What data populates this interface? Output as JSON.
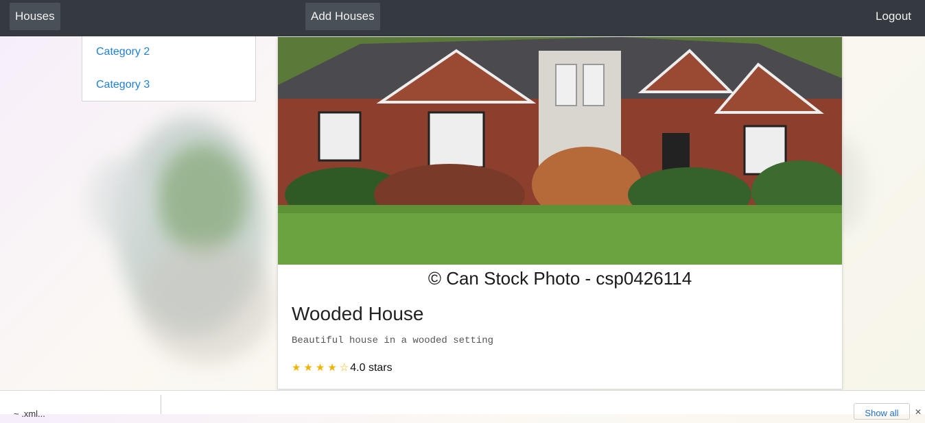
{
  "navbar": {
    "houses_label": "Houses",
    "add_houses_label": "Add Houses",
    "logout_label": "Logout"
  },
  "dropdown": {
    "items": [
      {
        "label": "Category 2"
      },
      {
        "label": "Category 3"
      }
    ]
  },
  "card": {
    "image_caption": "© Can Stock Photo - csp0426114",
    "title": "Wooded House",
    "description": "Beautiful house in a wooded setting",
    "rating": {
      "value": 4,
      "max": 5,
      "label": "4.0 stars",
      "star_color": "#f0b400"
    }
  },
  "downloads_bar": {
    "file_label": "~ .xml...",
    "show_all_label": "Show all"
  },
  "colors": {
    "navbar_bg": "#343a40",
    "link": "#1e7fd8"
  }
}
